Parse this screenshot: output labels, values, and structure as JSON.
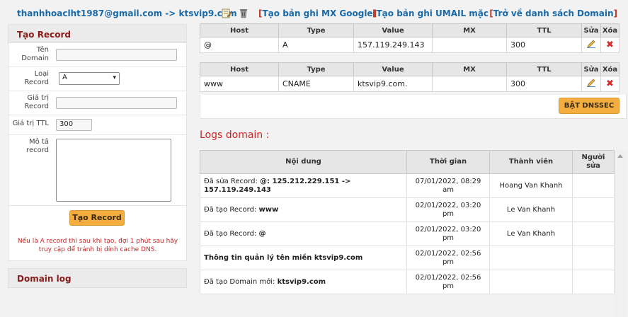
{
  "header": {
    "email_domain": "thanhhoaclht1987@gmail.com -> ktsvip9.com",
    "link_mx": "Tạo bản ghi MX Google",
    "link_umail": "Tạo bản ghi UMAIL mặc",
    "link_back": "Trở về danh sách Domain",
    "icons": [
      "edit-icon",
      "trash-icon"
    ]
  },
  "create_record": {
    "title": "Tạo Record",
    "labels": {
      "name": "Tên Domain",
      "type": "Loại Record",
      "value": "Giá trị Record",
      "ttl": "Giá trị TTL",
      "desc": "Mô tả record"
    },
    "name_value": "",
    "type_selected": "A",
    "value_value": "",
    "ttl_value": "300",
    "desc_value": "",
    "submit_label": "Tạo Record",
    "warning": "Nếu là A record thì sau khi tạo, đợi 1 phút sau hãy truy cập để tránh bị dính cache DNS."
  },
  "domain_log_title": "Domain log",
  "record_columns": [
    "Host",
    "Type",
    "Value",
    "MX",
    "TTL",
    "Sửa",
    "Xóa"
  ],
  "records": [
    {
      "host": "@",
      "type": "A",
      "value": "157.119.249.143",
      "mx": "",
      "ttl": "300"
    },
    {
      "host": "www",
      "type": "CNAME",
      "value": "ktsvip9.com.",
      "mx": "",
      "ttl": "300"
    }
  ],
  "dnssec_label": "BẬT DNSSEC",
  "logs": {
    "title": "Logs domain :",
    "columns": [
      "Nội dung",
      "Thời gian",
      "Thành viên",
      "Người sửa"
    ],
    "rows": [
      {
        "prefix": "Đã sửa Record: ",
        "bold": "@: 125.212.229.151 -> 157.119.249.143",
        "time": "07/01/2022, 08:29 am",
        "member": "Hoang Van Khanh",
        "editor": ""
      },
      {
        "prefix": "Đã tạo Record: ",
        "bold": "www",
        "time": "02/01/2022, 03:20 pm",
        "member": "Le Van Khanh",
        "editor": ""
      },
      {
        "prefix": "Đã tạo Record: ",
        "bold": "@",
        "time": "02/01/2022, 03:20 pm",
        "member": "Le Van Khanh",
        "editor": ""
      },
      {
        "prefix": "",
        "bold": "Thông tin quản lý tên miền ktsvip9.com",
        "time": "02/01/2022, 02:56 pm",
        "member": "",
        "editor": ""
      },
      {
        "prefix": "Đã tạo Domain mới: ",
        "bold": "ktsvip9.com",
        "time": "02/01/2022, 02:56 pm",
        "member": "",
        "editor": ""
      }
    ]
  },
  "colors": {
    "accent_orange": "#f4ad3f",
    "link_blue": "#1a6aa8",
    "title_red": "#8b1a1a",
    "log_red": "#c62828"
  }
}
